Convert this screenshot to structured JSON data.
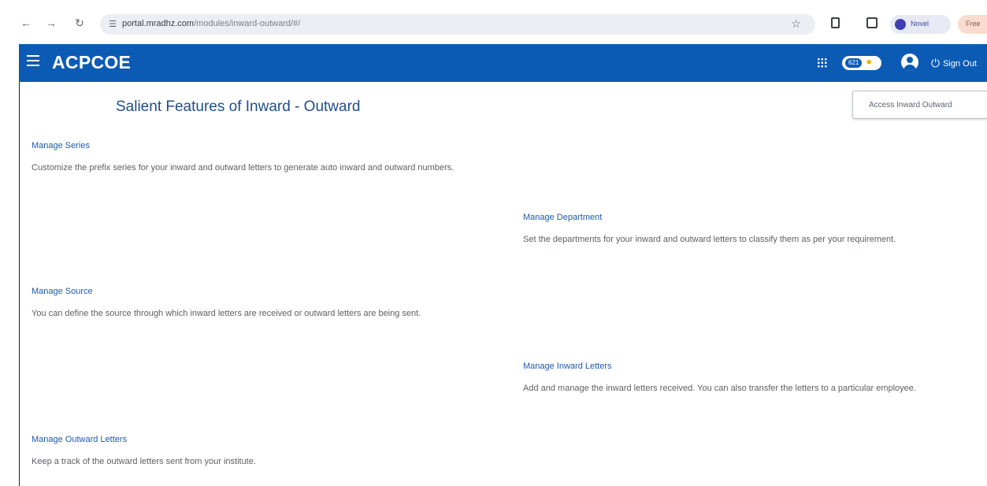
{
  "browser": {
    "url_domain": "portal.mradhz.com",
    "url_path": "/modules/inward-outward/#/",
    "profile_label": "Novel",
    "alt_profile_label": "Free"
  },
  "app": {
    "brand": "ACPCOE",
    "badge_count": "621",
    "signout_label": "Sign Out"
  },
  "page": {
    "title": "Salient Features of Inward - Outward",
    "access_button": "Access Inward Outward"
  },
  "features": [
    {
      "title": "Manage Series",
      "description": "Customize the prefix series for your inward and outward letters to generate auto inward and outward numbers."
    },
    {
      "title": "Manage Department",
      "description": "Set the departments for your inward and outward letters to classify them as per your requirement."
    },
    {
      "title": "Manage Source",
      "description": "You can define the source through which inward letters are received or outward letters are being sent."
    },
    {
      "title": "Manage Inward Letters",
      "description": "Add and manage the inward letters received. You can also transfer the letters to a particular employee."
    },
    {
      "title": "Manage Outward Letters",
      "description": "Keep a track of the outward letters sent from your institute."
    }
  ],
  "icons": {
    "back": "arrow-left-icon",
    "forward": "arrow-right-icon",
    "reload": "reload-icon",
    "bookmark": "star-icon",
    "menu": "hamburger-icon",
    "apps": "grid-icon",
    "trophy": "trophy-icon",
    "user": "user-icon",
    "power": "power-icon"
  },
  "colors": {
    "header": "#0b5bb5",
    "link": "#1d58b0",
    "title": "#1f4f8a"
  }
}
